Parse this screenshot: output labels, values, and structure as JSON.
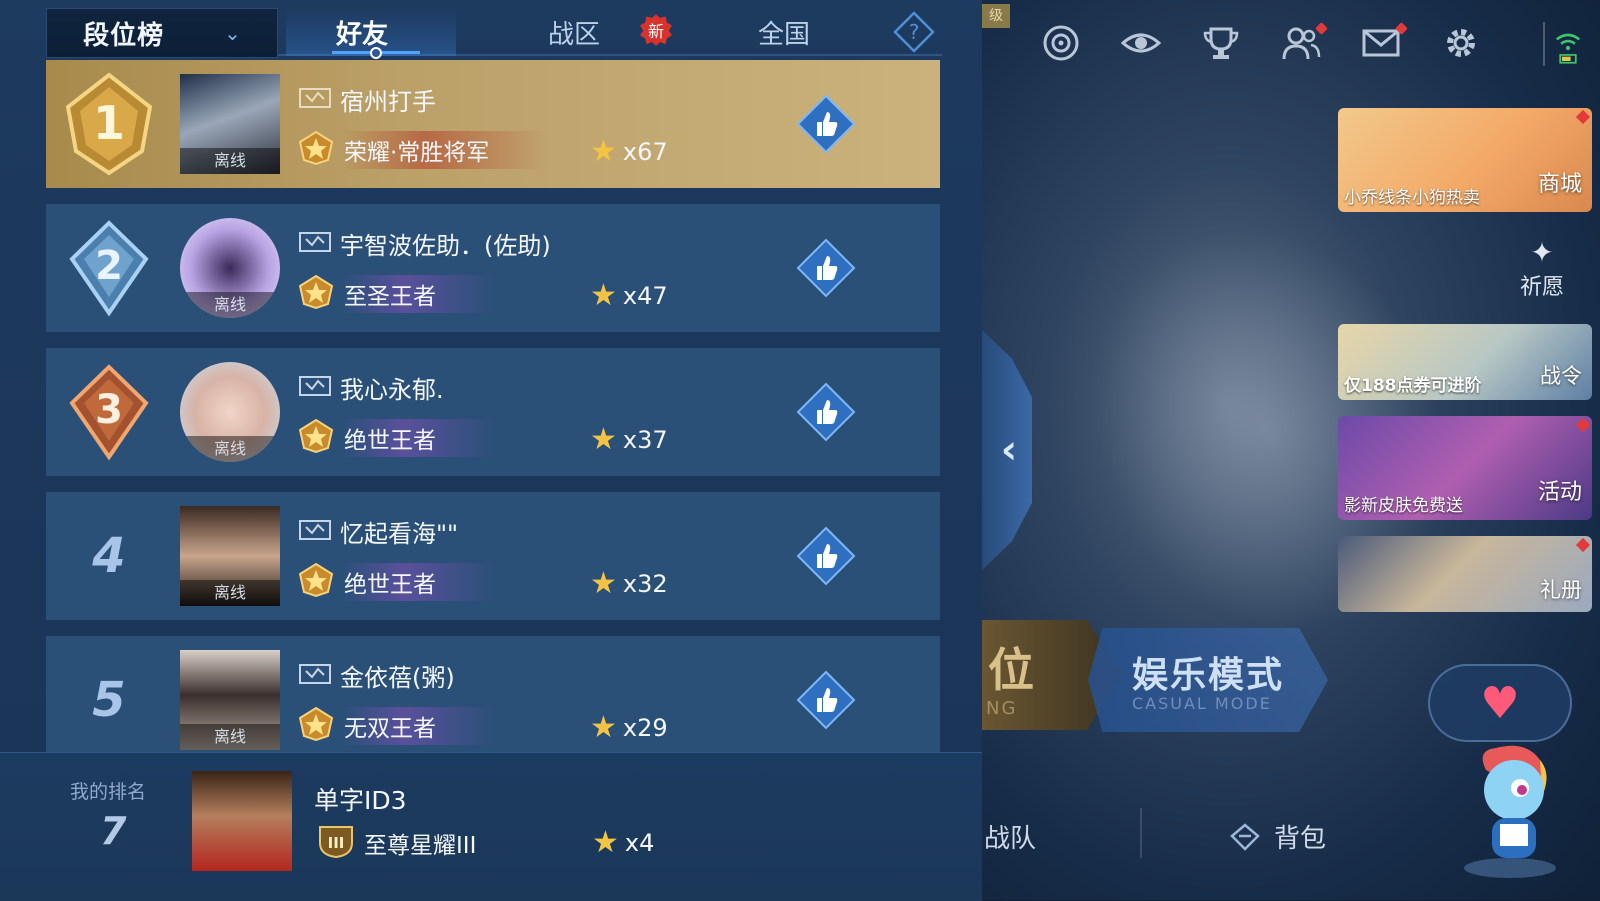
{
  "header": {
    "dropdown_label": "段位榜",
    "tabs": [
      {
        "label": "好友",
        "active": true
      },
      {
        "label": "战区",
        "active": false,
        "badge": "新"
      },
      {
        "label": "全国",
        "active": false
      }
    ],
    "help_icon": "question-icon"
  },
  "leaderboard": {
    "status_text": "离线",
    "rows": [
      {
        "rank": "1",
        "name": "宿州打手",
        "tier": "荣耀·常胜将军",
        "stars": "x67"
      },
      {
        "rank": "2",
        "name": "宇智波佐助．(佐助)",
        "tier": "至圣王者",
        "stars": "x47"
      },
      {
        "rank": "3",
        "name": "我心永郁.",
        "tier": "绝世王者",
        "stars": "x37"
      },
      {
        "rank": "4",
        "name": "忆起看海\"\"",
        "tier": "绝世王者",
        "stars": "x32"
      },
      {
        "rank": "5",
        "name": "金依蓓(粥)",
        "tier": "无双王者",
        "stars": "x29"
      }
    ]
  },
  "my_rank": {
    "label": "我的排名",
    "rank": "7",
    "name": "单字ID3",
    "tier_badge": "III",
    "tier": "至尊星耀III",
    "stars": "x4"
  },
  "right_panel": {
    "level_tag": "级",
    "shop_caption": "小乔线条小狗热卖",
    "shop_label": "商城",
    "wish_label": "祈愿",
    "pass_caption": "仅188点券可进阶",
    "pass_label": "战令",
    "event_caption": "影新皮肤免费送",
    "event_label": "活动",
    "gift_label": "礼册",
    "rank_mode_big": "位",
    "rank_mode_small": "NG",
    "casual_mode": "娱乐模式",
    "casual_mode_en": "CASUAL MODE",
    "team_label": "战队",
    "bag_label": "背包"
  },
  "colors": {
    "panel_bg": "#1d3a5f",
    "row_bg": "#2a5078",
    "first_row_gold": "#bba068",
    "accent_blue": "#4fa3ff",
    "badge_red": "#d8322c"
  }
}
